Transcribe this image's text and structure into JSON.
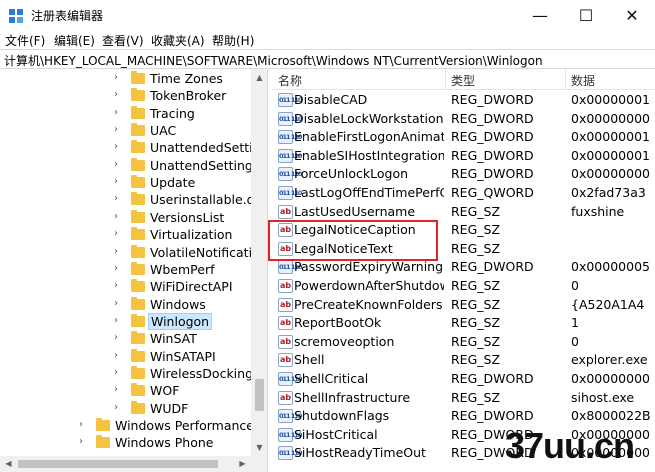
{
  "window": {
    "title": "注册表编辑器",
    "minimize": "—",
    "maximize": "☐",
    "close": "✕"
  },
  "menu": [
    "文件(F)",
    "编辑(E)",
    "查看(V)",
    "收藏夹(A)",
    "帮助(H)"
  ],
  "address": "计算机\\HKEY_LOCAL_MACHINE\\SOFTWARE\\Microsoft\\Windows NT\\CurrentVersion\\Winlogon",
  "tree": {
    "items": [
      {
        "label": "Time Zones",
        "level": 2
      },
      {
        "label": "TokenBroker",
        "level": 2
      },
      {
        "label": "Tracing",
        "level": 2
      },
      {
        "label": "UAC",
        "level": 2
      },
      {
        "label": "UnattendedSettings",
        "level": 2
      },
      {
        "label": "UnattendSettings",
        "level": 2
      },
      {
        "label": "Update",
        "level": 2
      },
      {
        "label": "Userinstallable.drivers",
        "level": 2
      },
      {
        "label": "VersionsList",
        "level": 2
      },
      {
        "label": "Virtualization",
        "level": 2
      },
      {
        "label": "VolatileNotifications",
        "level": 2
      },
      {
        "label": "WbemPerf",
        "level": 2
      },
      {
        "label": "WiFiDirectAPI",
        "level": 2
      },
      {
        "label": "Windows",
        "level": 2
      },
      {
        "label": "Winlogon",
        "level": 2,
        "selected": true
      },
      {
        "label": "WinSAT",
        "level": 2
      },
      {
        "label": "WinSATAPI",
        "level": 2
      },
      {
        "label": "WirelessDocking",
        "level": 2
      },
      {
        "label": "WOF",
        "level": 2
      },
      {
        "label": "WUDF",
        "level": 2
      },
      {
        "label": "Windows Performance Toolkit",
        "level": 1
      },
      {
        "label": "Windows Phone",
        "level": 1
      }
    ]
  },
  "values": {
    "headers": {
      "name": "名称",
      "type": "类型",
      "data": "数据"
    },
    "rows": [
      {
        "name": "DisableCAD",
        "type": "REG_DWORD",
        "data": "0x00000001",
        "icon": "bin"
      },
      {
        "name": "DisableLockWorkstation",
        "type": "REG_DWORD",
        "data": "0x00000000",
        "icon": "bin"
      },
      {
        "name": "EnableFirstLogonAnimation",
        "type": "REG_DWORD",
        "data": "0x00000001",
        "icon": "bin"
      },
      {
        "name": "EnableSIHostIntegration",
        "type": "REG_DWORD",
        "data": "0x00000001",
        "icon": "bin"
      },
      {
        "name": "ForceUnlockLogon",
        "type": "REG_DWORD",
        "data": "0x00000000",
        "icon": "bin"
      },
      {
        "name": "LastLogOffEndTimePerfCounter",
        "type": "REG_QWORD",
        "data": "0x2fad73a3",
        "icon": "bin"
      },
      {
        "name": "LastUsedUsername",
        "type": "REG_SZ",
        "data": "fuxshine",
        "icon": "sz"
      },
      {
        "name": "LegalNoticeCaption",
        "type": "REG_SZ",
        "data": "",
        "icon": "sz"
      },
      {
        "name": "LegalNoticeText",
        "type": "REG_SZ",
        "data": "",
        "icon": "sz"
      },
      {
        "name": "PasswordExpiryWarning",
        "type": "REG_DWORD",
        "data": "0x00000005",
        "icon": "bin"
      },
      {
        "name": "PowerdownAfterShutdown",
        "type": "REG_SZ",
        "data": "0",
        "icon": "sz"
      },
      {
        "name": "PreCreateKnownFolders",
        "type": "REG_SZ",
        "data": "{A520A1A4",
        "icon": "sz"
      },
      {
        "name": "ReportBootOk",
        "type": "REG_SZ",
        "data": "1",
        "icon": "sz"
      },
      {
        "name": "scremoveoption",
        "type": "REG_SZ",
        "data": "0",
        "icon": "sz"
      },
      {
        "name": "Shell",
        "type": "REG_SZ",
        "data": "explorer.exe",
        "icon": "sz"
      },
      {
        "name": "ShellCritical",
        "type": "REG_DWORD",
        "data": "0x00000000",
        "icon": "bin"
      },
      {
        "name": "ShellInfrastructure",
        "type": "REG_SZ",
        "data": "sihost.exe",
        "icon": "sz"
      },
      {
        "name": "ShutdownFlags",
        "type": "REG_DWORD",
        "data": "0x8000022B",
        "icon": "bin"
      },
      {
        "name": "SiHostCritical",
        "type": "REG_DWORD",
        "data": "0x00000000",
        "icon": "bin"
      },
      {
        "name": "SiHostReadyTimeOut",
        "type": "REG_DWORD",
        "data": "0x00000000",
        "icon": "bin"
      }
    ]
  },
  "watermark": "37uu.cn",
  "icons": {
    "sz": "ab",
    "bin": "011 110"
  }
}
